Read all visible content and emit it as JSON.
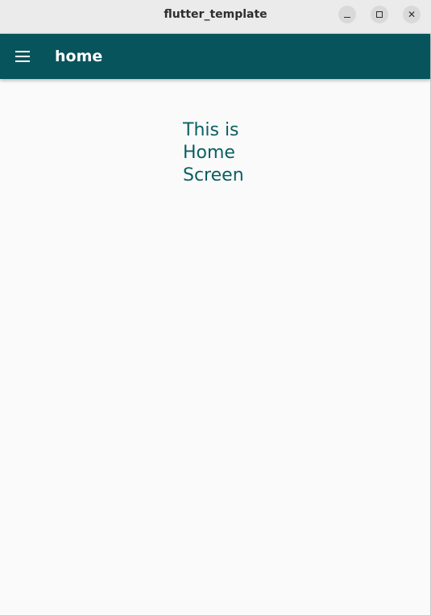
{
  "window": {
    "title": "flutter_template",
    "controls": {
      "minimize_icon": "minimize-icon",
      "maximize_icon": "maximize-icon",
      "close_icon": "close-icon",
      "close_glyph": "✕"
    }
  },
  "appbar": {
    "title": "home",
    "menu_icon": "menu-icon",
    "background": "#08545c"
  },
  "main": {
    "text": "This is\nHome\nScreen",
    "text_color": "#0a5f62"
  },
  "colors": {
    "page_background": "#fafafa",
    "titlebar_background": "#ebebeb"
  }
}
